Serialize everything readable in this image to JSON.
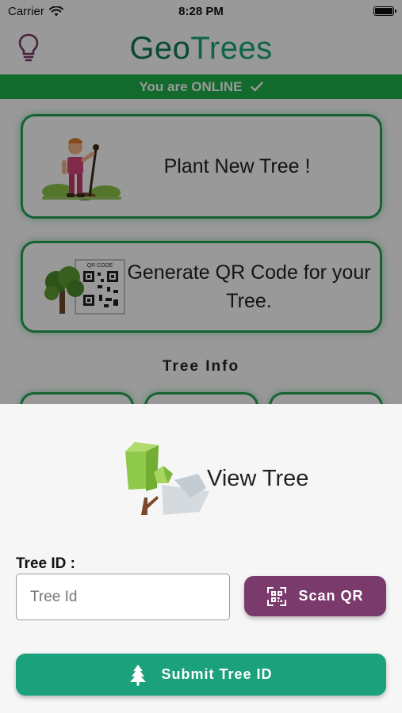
{
  "status_bar": {
    "carrier": "Carrier",
    "time": "8:28 PM",
    "icons": [
      "wifi-icon",
      "battery-icon"
    ]
  },
  "header": {
    "logo_part1": "Geo",
    "logo_part2": "Trees",
    "left_icon": "lightbulb-icon"
  },
  "connection": {
    "text": "You are ONLINE",
    "icon": "checkmark-icon"
  },
  "cards": [
    {
      "label": "Plant New Tree !",
      "icon": "gardener-illustration"
    },
    {
      "label": "Generate QR Code for your Tree.",
      "icon": "tree-qr-illustration",
      "qr_caption": "QR CODE"
    }
  ],
  "tree_info": {
    "title": "Tree Info"
  },
  "bottom_sheet": {
    "title": "View Tree",
    "icon": "low-poly-tree-icon",
    "tree_id_label": "Tree ID :",
    "tree_id_placeholder": "Tree Id",
    "tree_id_value": "",
    "scan_button": "Scan QR",
    "scan_icon": "qr-scan-icon",
    "submit_button": "Submit Tree ID",
    "submit_icon": "pine-tree-icon"
  },
  "colors": {
    "online_bar": "#1fb14c",
    "card_border": "#23a455",
    "scan_button": "#7a3a6b",
    "submit_button": "#1ba17b",
    "logo_dark": "#0f7a5a",
    "logo_light": "#19a77a"
  }
}
